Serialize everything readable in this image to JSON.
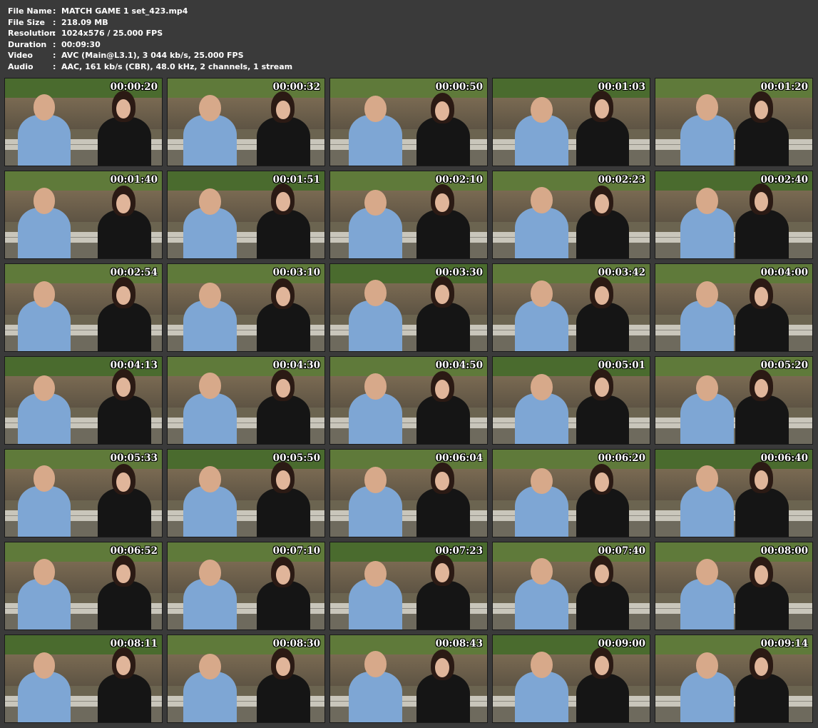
{
  "info": {
    "separator": ":",
    "rows": [
      {
        "label": "File Name",
        "value": "MATCH GAME 1 set_423.mp4"
      },
      {
        "label": "File Size",
        "value": "218.09 MB"
      },
      {
        "label": "Resolution",
        "value": "1024x576 / 25.000 FPS"
      },
      {
        "label": "Duration",
        "value": "00:09:30"
      },
      {
        "label": "Video",
        "value": "AVC (Main@L3.1), 3 044 kb/s, 25.000 FPS"
      },
      {
        "label": "Audio",
        "value": "AAC, 161 kb/s (CBR), 48.0 kHz, 2 channels, 1 stream"
      }
    ]
  },
  "thumbnails": [
    {
      "timestamp": "00:00:20"
    },
    {
      "timestamp": "00:00:32"
    },
    {
      "timestamp": "00:00:50"
    },
    {
      "timestamp": "00:01:03"
    },
    {
      "timestamp": "00:01:20"
    },
    {
      "timestamp": "00:01:40"
    },
    {
      "timestamp": "00:01:51"
    },
    {
      "timestamp": "00:02:10"
    },
    {
      "timestamp": "00:02:23"
    },
    {
      "timestamp": "00:02:40"
    },
    {
      "timestamp": "00:02:54"
    },
    {
      "timestamp": "00:03:10"
    },
    {
      "timestamp": "00:03:30"
    },
    {
      "timestamp": "00:03:42"
    },
    {
      "timestamp": "00:04:00"
    },
    {
      "timestamp": "00:04:13"
    },
    {
      "timestamp": "00:04:30"
    },
    {
      "timestamp": "00:04:50"
    },
    {
      "timestamp": "00:05:01"
    },
    {
      "timestamp": "00:05:20"
    },
    {
      "timestamp": "00:05:33"
    },
    {
      "timestamp": "00:05:50"
    },
    {
      "timestamp": "00:06:04"
    },
    {
      "timestamp": "00:06:20"
    },
    {
      "timestamp": "00:06:40"
    },
    {
      "timestamp": "00:06:52"
    },
    {
      "timestamp": "00:07:10"
    },
    {
      "timestamp": "00:07:23"
    },
    {
      "timestamp": "00:07:40"
    },
    {
      "timestamp": "00:08:00"
    },
    {
      "timestamp": "00:08:11"
    },
    {
      "timestamp": "00:08:30"
    },
    {
      "timestamp": "00:08:43"
    },
    {
      "timestamp": "00:09:00"
    },
    {
      "timestamp": "00:09:14"
    }
  ],
  "colors": {
    "background": "#3a3a3a",
    "text": "#ffffff",
    "shirt_blue": "#7ea6d4",
    "jacket_black": "#151515",
    "foliage": "#4a6b2e",
    "wall": "#7a6a52"
  }
}
